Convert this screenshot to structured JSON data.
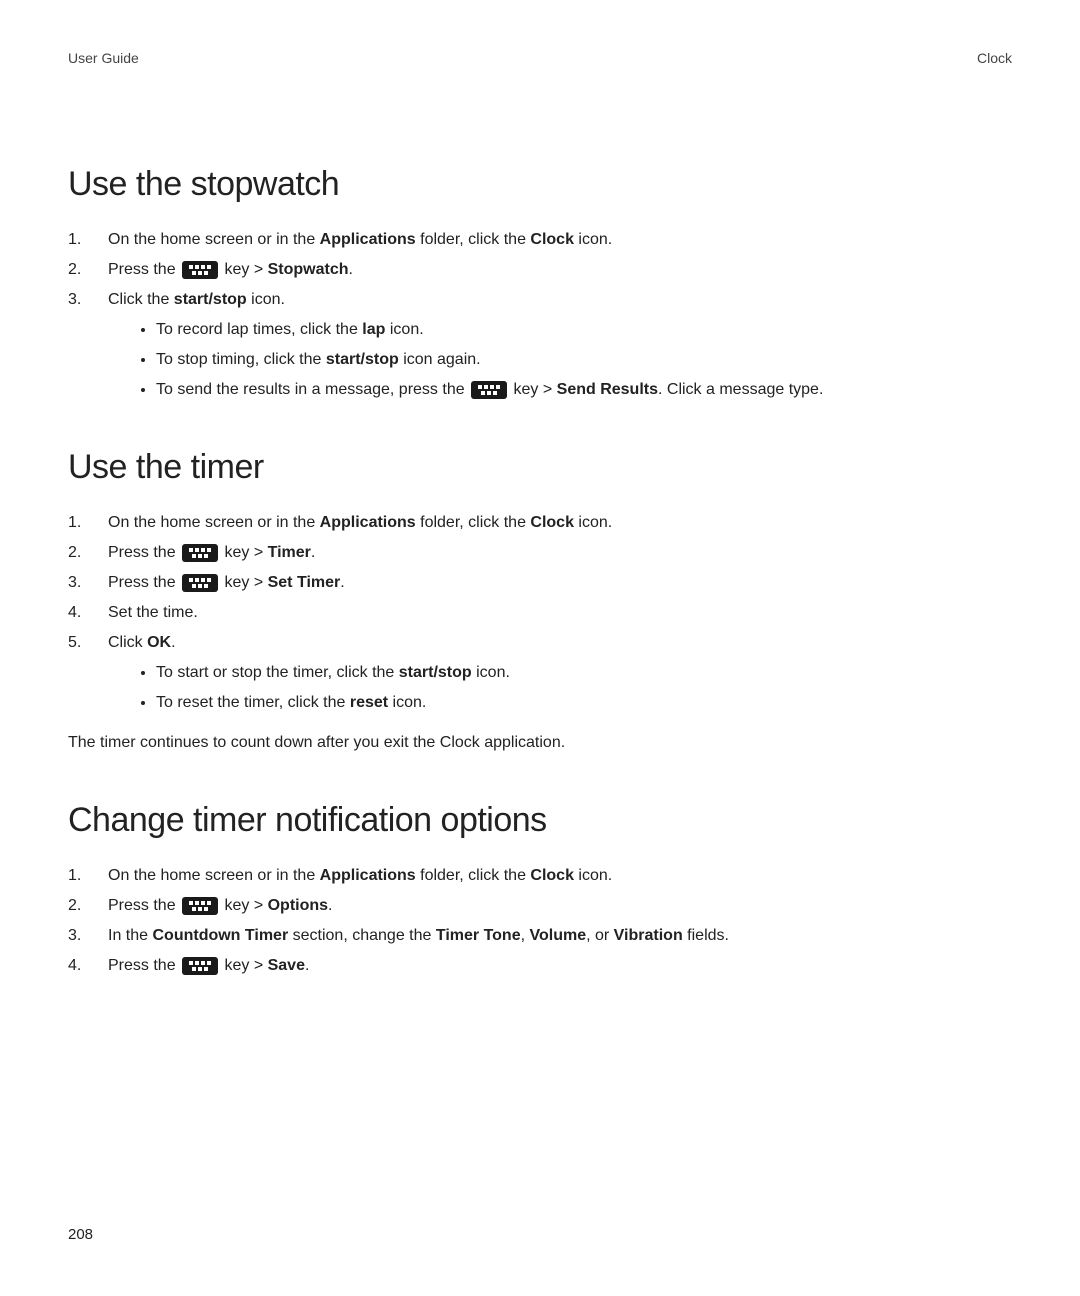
{
  "header": {
    "left": "User Guide",
    "right": "Clock"
  },
  "sections": {
    "stopwatch": {
      "title": "Use the stopwatch",
      "step1_a": "On the home screen or in the ",
      "step1_b": "Applications",
      "step1_c": " folder, click the ",
      "step1_d": "Clock",
      "step1_e": " icon.",
      "step2_a": "Press the ",
      "step2_b": " key > ",
      "step2_c": "Stopwatch",
      "step2_d": ".",
      "step3_a": "Click the ",
      "step3_b": "start/stop",
      "step3_c": " icon.",
      "sub1_a": "To record lap times, click the ",
      "sub1_b": "lap",
      "sub1_c": " icon.",
      "sub2_a": "To stop timing, click the ",
      "sub2_b": "start/stop",
      "sub2_c": " icon again.",
      "sub3_a": "To send the results in a message, press the ",
      "sub3_b": " key > ",
      "sub3_c": "Send Results",
      "sub3_d": ". Click a message type."
    },
    "timer": {
      "title": "Use the timer",
      "step1_a": "On the home screen or in the ",
      "step1_b": "Applications",
      "step1_c": " folder, click the ",
      "step1_d": "Clock",
      "step1_e": " icon.",
      "step2_a": "Press the ",
      "step2_b": " key > ",
      "step2_c": "Timer",
      "step2_d": ".",
      "step3_a": "Press the ",
      "step3_b": " key > ",
      "step3_c": "Set Timer",
      "step3_d": ".",
      "step4": "Set the time.",
      "step5_a": "Click ",
      "step5_b": "OK",
      "step5_c": ".",
      "sub1_a": "To start or stop the timer, click the ",
      "sub1_b": "start/stop",
      "sub1_c": " icon.",
      "sub2_a": "To reset the timer, click the ",
      "sub2_b": "reset",
      "sub2_c": " icon.",
      "note": "The timer continues to count down after you exit the Clock application."
    },
    "notif": {
      "title": "Change timer notification options",
      "step1_a": "On the home screen or in the ",
      "step1_b": "Applications",
      "step1_c": " folder, click the ",
      "step1_d": "Clock",
      "step1_e": " icon.",
      "step2_a": "Press the ",
      "step2_b": " key > ",
      "step2_c": "Options",
      "step2_d": ".",
      "step3_a": "In the ",
      "step3_b": "Countdown Timer",
      "step3_c": " section, change the ",
      "step3_d": "Timer Tone",
      "step3_e": ", ",
      "step3_f": "Volume",
      "step3_g": ", or ",
      "step3_h": "Vibration",
      "step3_i": " fields.",
      "step4_a": "Press the ",
      "step4_b": " key > ",
      "step4_c": "Save",
      "step4_d": "."
    }
  },
  "page_number": "208"
}
